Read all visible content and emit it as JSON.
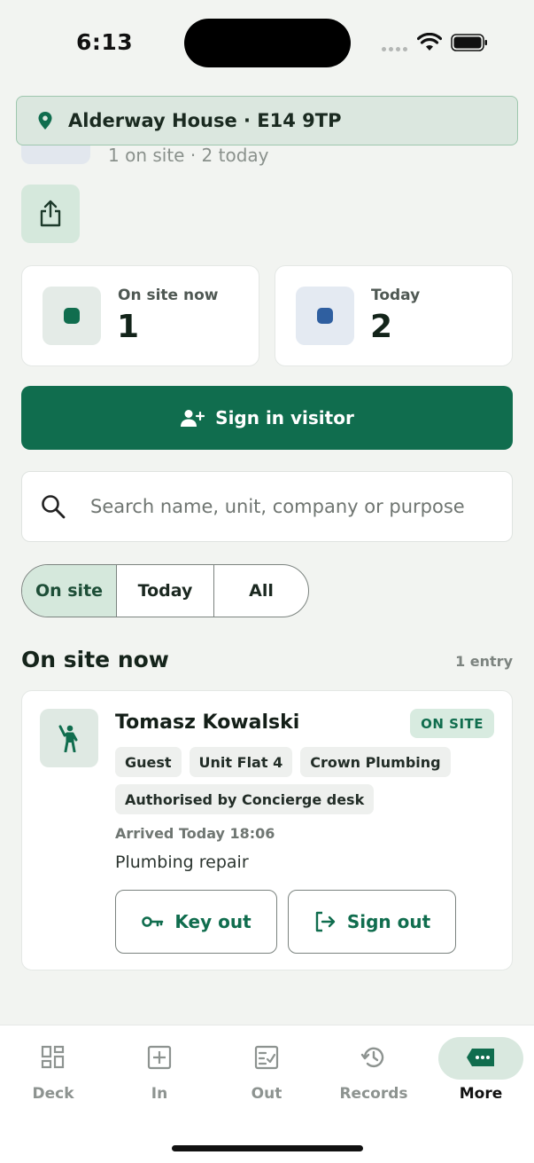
{
  "status_bar": {
    "time": "6:13"
  },
  "header": {
    "location": "Alderway House · E14 9TP",
    "summary": "1 on site · 2 today"
  },
  "stats": [
    {
      "label": "On site now",
      "value": "1",
      "color": "#106d4e",
      "bg": "#e4ebe7"
    },
    {
      "label": "Today",
      "value": "2",
      "color": "#2f5fa0",
      "bg": "#e4eaf2"
    }
  ],
  "actions": {
    "sign_in": "Sign in visitor"
  },
  "search": {
    "placeholder": "Search name, unit, company or purpose",
    "value": ""
  },
  "filters": {
    "options": [
      "On site",
      "Today",
      "All"
    ],
    "selected": "On site"
  },
  "section": {
    "title": "On site now",
    "count": "1 entry"
  },
  "visitor": {
    "name": "Tomasz Kowalski",
    "status": "ON SITE",
    "tags": [
      "Guest",
      "Unit Flat 4",
      "Crown Plumbing"
    ],
    "authorised": "Authorised by Concierge desk",
    "arrived": "Arrived Today 18:06",
    "purpose": "Plumbing repair",
    "key_out": "Key out",
    "sign_out": "Sign out"
  },
  "tabs": [
    {
      "label": "Deck",
      "icon": "grid-icon"
    },
    {
      "label": "In",
      "icon": "plus-square-icon"
    },
    {
      "label": "Out",
      "icon": "checklist-icon"
    },
    {
      "label": "Records",
      "icon": "history-icon"
    },
    {
      "label": "More",
      "icon": "more-icon",
      "active": true
    }
  ],
  "colors": {
    "accent": "#106d4e",
    "background": "#f2f4f1"
  }
}
